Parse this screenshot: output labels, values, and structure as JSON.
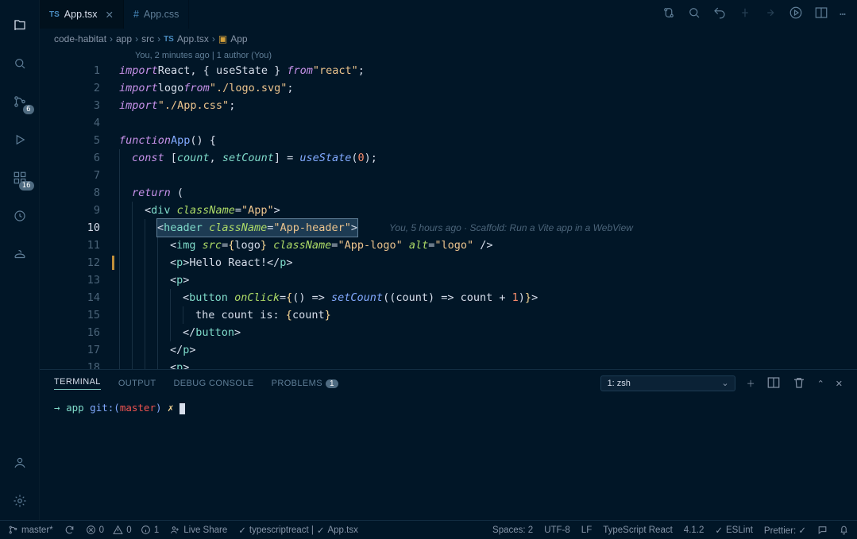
{
  "tabs": [
    {
      "badge": "TS",
      "label": "App.tsx",
      "active": true,
      "close": true
    },
    {
      "badge": "#",
      "label": "App.css",
      "active": false,
      "close": false
    }
  ],
  "breadcrumbs": {
    "parts": [
      "code-habitat",
      "app",
      "src"
    ],
    "file": "App.tsx",
    "symbol": "App"
  },
  "codelens": "You, 2 minutes ago | 1 author (You)",
  "blame_line10": "You, 5 hours ago · Scaffold: Run a Vite app in a WebView",
  "activity_badges": {
    "scm": "6",
    "ext": "16"
  },
  "code": {
    "l1": {
      "import": "import",
      "react": "React",
      "comma": ", { ",
      "useState": "useState",
      "close": " } ",
      "from": "from",
      "str": "\"react\"",
      "semi": ";"
    },
    "l2": {
      "import": "import",
      "logo": "logo",
      "from": "from",
      "str": "\"./logo.svg\"",
      "semi": ";"
    },
    "l3": {
      "import": "import",
      "str": "\"./App.css\"",
      "semi": ";"
    },
    "l5": {
      "function": "function",
      "name": "App",
      "parens": "() {"
    },
    "l6": {
      "const": "const",
      "open": " [",
      "count": "count",
      "comma": ", ",
      "setCount": "setCount",
      "close": "] = ",
      "useState": "useState",
      "arg": "(",
      "zero": "0",
      "end": ");"
    },
    "l8": {
      "return": "return",
      "paren": " ("
    },
    "l9": {
      "open": "<",
      "tag": "div",
      "sp": " ",
      "attr": "className",
      "eq": "=",
      "val": "\"App\"",
      "close": ">"
    },
    "l10": {
      "open": "<",
      "tag": "header",
      "sp": " ",
      "attr": "className",
      "eq": "=",
      "val": "\"App-header\"",
      "close": ">"
    },
    "l11": {
      "open": "<",
      "tag": "img",
      "sp": " ",
      "a1": "src",
      "eq": "=",
      "bopen": "{",
      "logo": "logo",
      "bclose": "}",
      "sp2": " ",
      "a2": "className",
      "v2": "\"App-logo\"",
      "sp3": " ",
      "a3": "alt",
      "v3": "\"logo\"",
      "end": " />"
    },
    "l12": {
      "open": "<",
      "tag": "p",
      "close": ">",
      "text": "Hello React!",
      "copen": "</",
      "ctag": "p",
      "cend": ">"
    },
    "l13": {
      "open": "<",
      "tag": "p",
      "close": ">"
    },
    "l14": {
      "open": "<",
      "tag": "button",
      "sp": " ",
      "attr": "onClick",
      "eq": "=",
      "b1": "{",
      "arrow": "() => ",
      "fn": "setCount",
      "p1": "((",
      "count": "count",
      "p2": ") => ",
      "count2": "count",
      "plus": " + ",
      "one": "1",
      "p3": ")",
      "b2": "}",
      "end": ">"
    },
    "l15": {
      "text": "the count is: ",
      "b1": "{",
      "count": "count",
      "b2": "}"
    },
    "l16": {
      "open": "</",
      "tag": "button",
      "close": ">"
    },
    "l17": {
      "open": "</",
      "tag": "p",
      "close": ">"
    },
    "l18": {
      "open": "<",
      "tag": "p",
      "close": ">"
    }
  },
  "panel": {
    "tabs": [
      "TERMINAL",
      "OUTPUT",
      "DEBUG CONSOLE",
      "PROBLEMS"
    ],
    "problems_badge": "1",
    "shell": "1: zsh",
    "prompt": {
      "arrow": "→",
      "path": "app",
      "git": "git:(",
      "branch": "master",
      "gitc": ")",
      "x": "✗"
    }
  },
  "status": {
    "branch": "master*",
    "errors": "0",
    "warnings": "0",
    "info": "1",
    "liveshare": "Live Share",
    "lang_check": "typescriptreact | ",
    "file_check": "App.tsx",
    "spaces": "Spaces: 2",
    "encoding": "UTF-8",
    "eol": "LF",
    "lang": "TypeScript React",
    "version": "4.1.2",
    "eslint": "ESLint",
    "prettier": "Prettier: ✓"
  }
}
